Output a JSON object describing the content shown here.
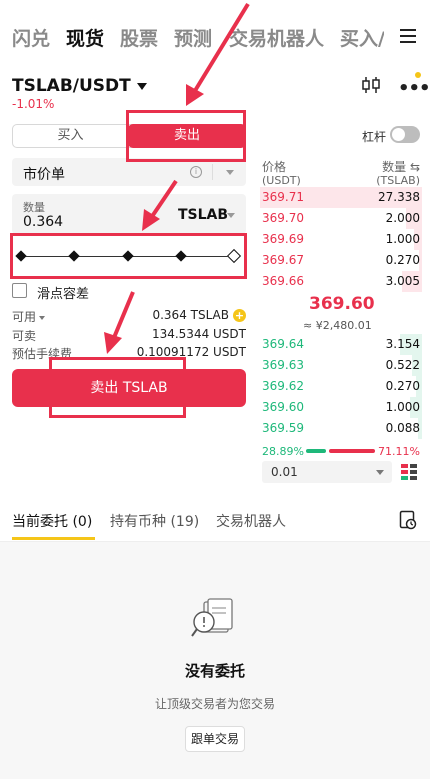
{
  "nav": {
    "tabs": [
      {
        "label": "闪兑",
        "active": false
      },
      {
        "label": "现货",
        "active": true
      },
      {
        "label": "股票",
        "active": false
      },
      {
        "label": "预测",
        "active": false
      },
      {
        "label": "交易机器人",
        "active": false
      },
      {
        "label": "买入/",
        "active": false
      }
    ]
  },
  "pair": {
    "symbol": "TSLAB/USDT",
    "change": "-1.01%"
  },
  "trade": {
    "buy_label": "买入",
    "sell_label": "卖出",
    "leverage_label": "杠杆",
    "order_type": "市价单",
    "quantity_label": "数量",
    "quantity_value": "0.364",
    "quantity_unit": "TSLAB",
    "slider_level": 1.0,
    "slippage_label": "滑点容差",
    "available_label": "可用",
    "available_value": "0.364 TSLAB",
    "sellable_label": "可卖",
    "sellable_value": "134.5344 USDT",
    "fee_label": "预估手续费",
    "fee_value": "0.10091172 USDT",
    "submit_label": "卖出 TSLAB"
  },
  "orderbook": {
    "price_header": "价格",
    "price_unit": "(USDT)",
    "qty_header": "数量 ⇆",
    "qty_unit": "(TSLAB)",
    "asks": [
      {
        "price": "369.71",
        "qty": "27.338"
      },
      {
        "price": "369.70",
        "qty": "2.000"
      },
      {
        "price": "369.69",
        "qty": "1.000"
      },
      {
        "price": "369.67",
        "qty": "0.270"
      },
      {
        "price": "369.66",
        "qty": "3.005"
      }
    ],
    "mid_price": "369.60",
    "mid_fiat": "≈ ¥2,480.01",
    "bids": [
      {
        "price": "369.64",
        "qty": "3.154"
      },
      {
        "price": "369.63",
        "qty": "0.522"
      },
      {
        "price": "369.62",
        "qty": "0.270"
      },
      {
        "price": "369.60",
        "qty": "1.000"
      },
      {
        "price": "369.59",
        "qty": "0.088"
      }
    ],
    "buy_ratio": "28.89%",
    "sell_ratio": "71.11%",
    "precision": "0.01"
  },
  "bottom": {
    "tabs": [
      {
        "label": "当前委托 (0)",
        "active": true
      },
      {
        "label": "持有币种 (19)",
        "active": false
      },
      {
        "label": "交易机器人",
        "active": false
      }
    ],
    "empty_title": "没有委托",
    "empty_sub": "让顶级交易者为您交易",
    "follow_label": "跟单交易"
  },
  "colors": {
    "sell": "#e8304c",
    "buy": "#1eb87a",
    "accent": "#f5c518"
  }
}
